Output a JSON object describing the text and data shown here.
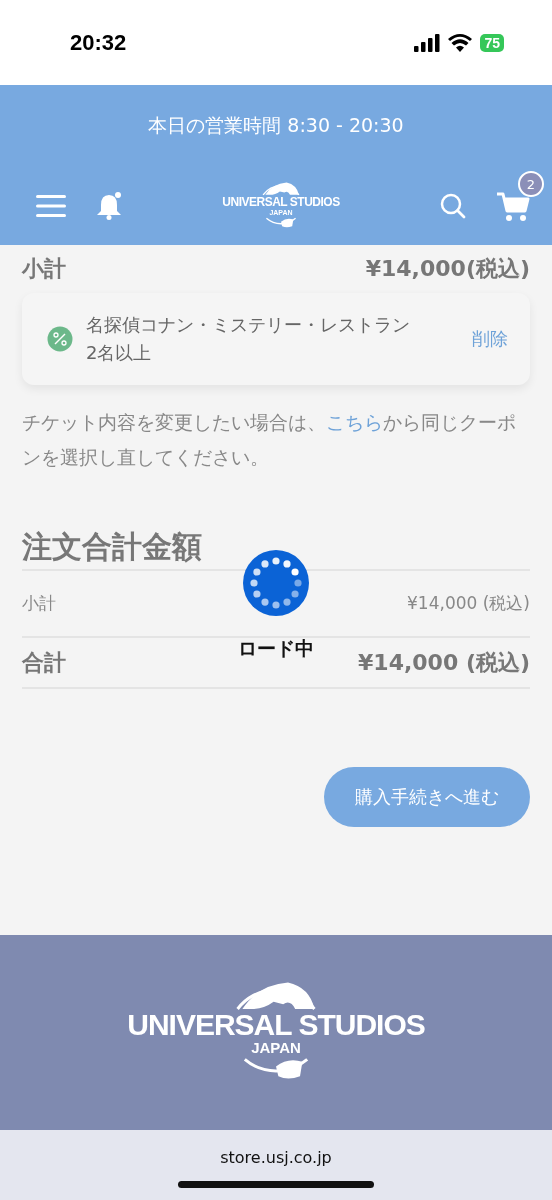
{
  "status_bar": {
    "time": "20:32",
    "battery": "75"
  },
  "header": {
    "hours": "本日の営業時間 8:30 - 20:30",
    "logo": {
      "title": "UNIVERSAL STUDIOS",
      "subtitle": "JAPAN"
    },
    "cart_count": "2"
  },
  "cart": {
    "subtotal_label": "小計",
    "subtotal_value": "¥14,000(税込)",
    "coupon": {
      "name": "名探偵コナン・ミステリー・レストラン",
      "condition": "2名以上",
      "remove": "削除"
    },
    "note": {
      "before": "チケット内容を変更したい場合は、",
      "link": "こちら",
      "after": "から同じクーポンを選択し直してください。"
    }
  },
  "order_total": {
    "title": "注文合計金額",
    "rows": [
      {
        "kind": "normal",
        "label": "小計",
        "value": "¥14,000 (税込)"
      },
      {
        "kind": "total",
        "label": "合計",
        "value": "¥14,000 (税込)"
      }
    ]
  },
  "checkout_button": "購入手続きへ進む",
  "loading": {
    "label": "ロード中"
  },
  "footer": {
    "logo": {
      "title": "UNIVERSAL STUDIOS",
      "subtitle": "JAPAN"
    }
  },
  "browser": {
    "url": "store.usj.co.jp"
  }
}
